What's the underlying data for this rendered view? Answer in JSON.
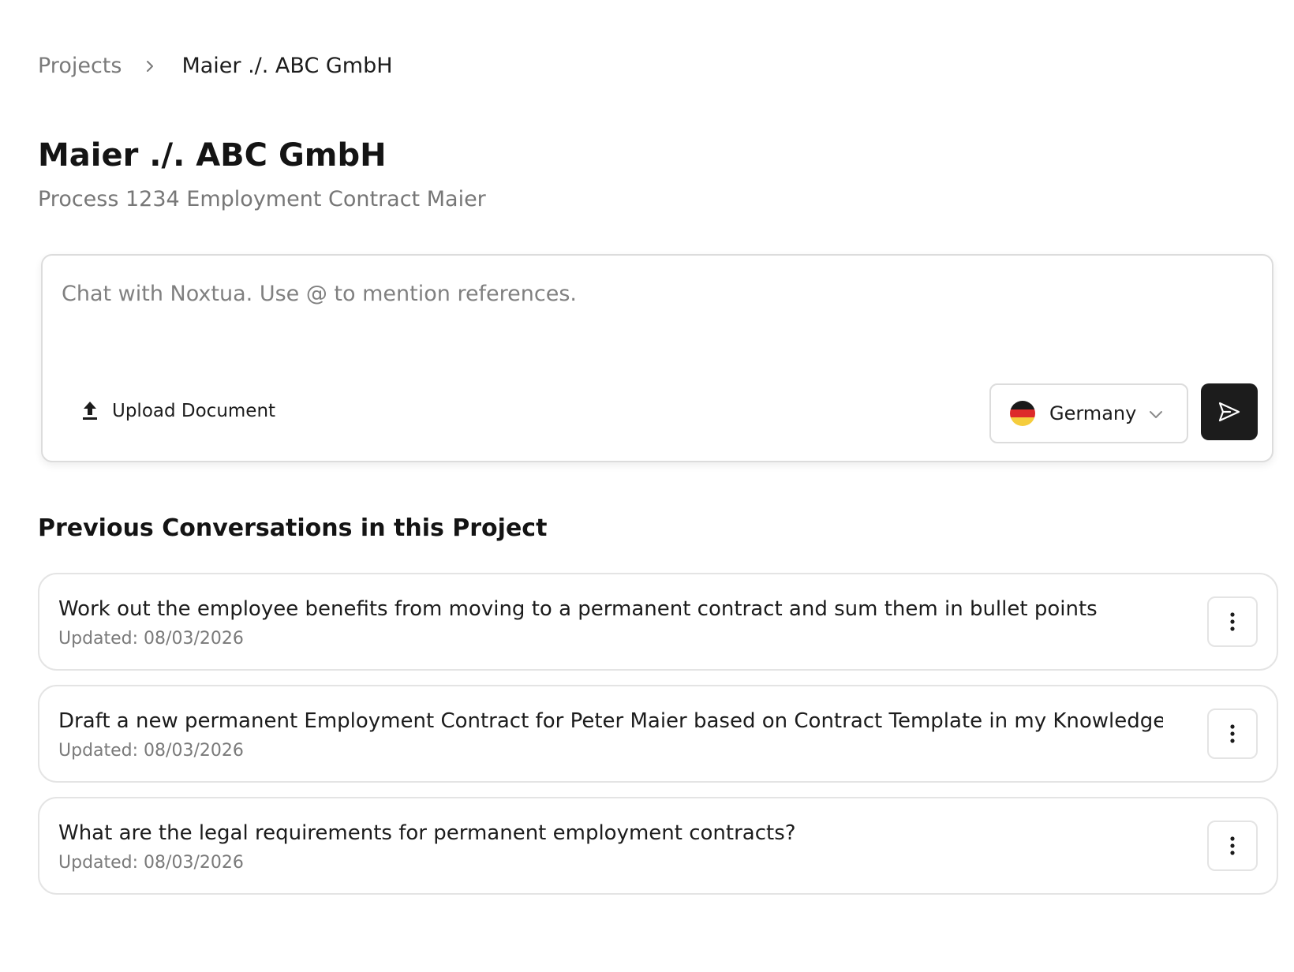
{
  "breadcrumb": {
    "root": "Projects",
    "current": "Maier ./. ABC GmbH"
  },
  "header": {
    "title": "Maier ./. ABC GmbH",
    "subtitle": "Process 1234 Employment Contract Maier"
  },
  "composer": {
    "placeholder": "Chat with Noxtua. Use @ to mention references.",
    "value": "",
    "upload_label": "Upload Document",
    "upload_icon": "upload-icon",
    "country": "Germany",
    "country_flag_colors": [
      "#1a1a1a",
      "#dd2a2a",
      "#f5cd3d"
    ],
    "send_icon": "send-icon"
  },
  "conversations": {
    "heading": "Previous Conversations in this Project",
    "items": [
      {
        "title": "Work out the employee benefits from moving to a permanent contract and sum them in bullet points",
        "updated": "Updated: 08/03/2026"
      },
      {
        "title": "Draft a new permanent Employment Contract for Peter Maier based on Contract Template in my Knowledge",
        "updated": "Updated: 08/03/2026"
      },
      {
        "title": "What are the legal requirements for permanent employment contracts?",
        "updated": "Updated: 08/03/2026"
      }
    ]
  },
  "colors": {
    "primary_dark": "#1c1c1c",
    "muted_text": "#7a7a7a",
    "border": "#dcdcdc"
  }
}
